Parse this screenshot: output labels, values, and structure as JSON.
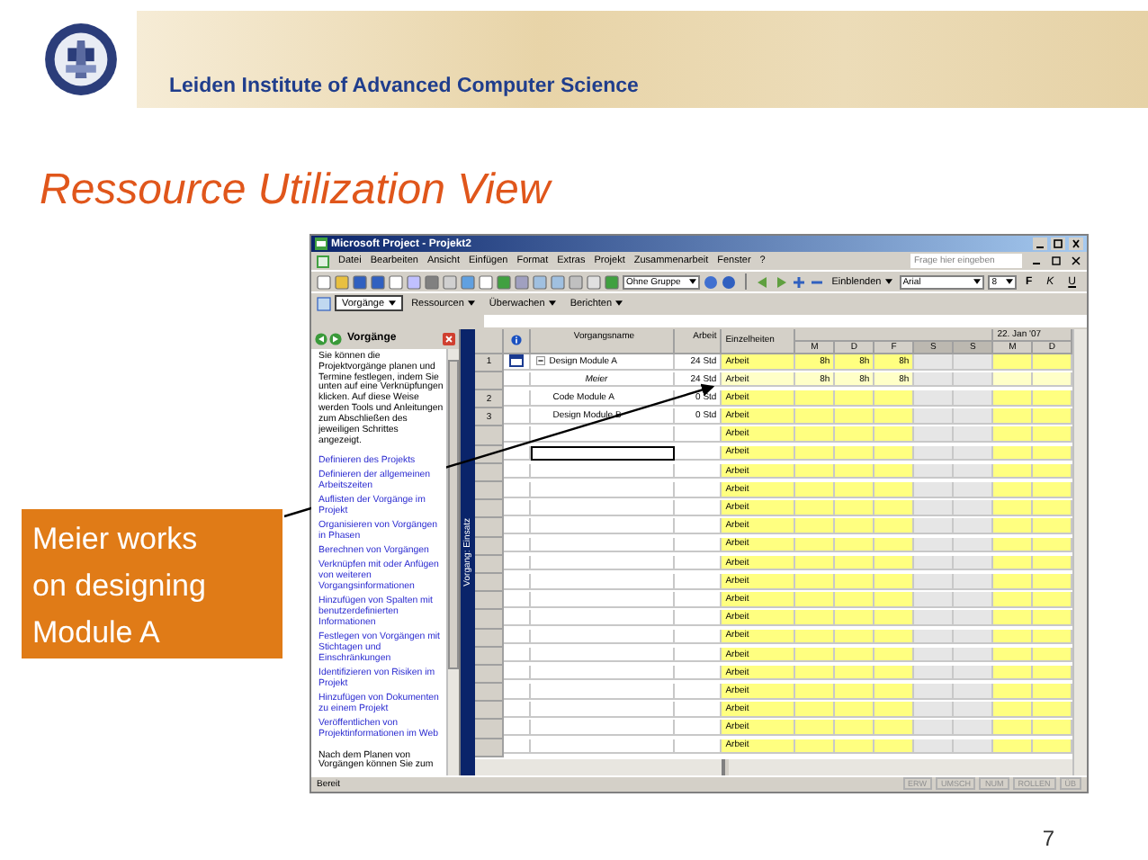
{
  "header": {
    "institute": "Leiden Institute of Advanced Computer Science"
  },
  "title": "Ressource Utilization View",
  "callout": {
    "text": "Meier works on designing Module A"
  },
  "app": {
    "window_title": "Microsoft Project - Projekt2",
    "menu": [
      "Datei",
      "Bearbeiten",
      "Ansicht",
      "Einfügen",
      "Format",
      "Extras",
      "Projekt",
      "Zusammenarbeit",
      "Fenster",
      "?"
    ],
    "help_placeholder": "Frage hier eingeben",
    "toolbar": {
      "group": "Ohne Gruppe",
      "show": "Einblenden",
      "font": "Arial",
      "size": "8",
      "format_buttons": [
        {
          "label": "F",
          "kind": "bold"
        },
        {
          "label": "K",
          "kind": "italic"
        },
        {
          "label": "U",
          "kind": "underline"
        }
      ]
    },
    "guide_toolbar": [
      {
        "label": "Vorgänge",
        "selected": true
      },
      {
        "label": "Ressourcen",
        "selected": false
      },
      {
        "label": "Überwachen",
        "selected": false
      },
      {
        "label": "Berichten",
        "selected": false
      }
    ],
    "task_pane": {
      "title": "Vorgänge",
      "intro": "Sie können die Projektvorgänge planen und Termine festlegen, indem Sie unten auf eine Verknüpfungen klicken. Auf diese Weise werden Tools und Anleitungen zum Abschließen des jeweiligen Schrittes angezeigt.",
      "links": [
        "Definieren des Projekts",
        "Definieren der allgemeinen Arbeitszeiten",
        "Auflisten der Vorgänge im Projekt",
        "Organisieren von Vorgängen in Phasen",
        "Berechnen von Vorgängen",
        "Verknüpfen mit oder Anfügen von weiteren Vorgangsinformationen",
        "Hinzufügen von Spalten mit benutzerdefinierten Informationen",
        "Festlegen von Vorgängen mit Stichtagen und Einschränkungen",
        "Identifizieren von Risiken im Projekt",
        "Hinzufügen von Dokumenten zu einem Projekt",
        "Veröffentlichen von Projektinformationen im Web"
      ],
      "footer": "Nach dem Planen von Vorgängen können Sie zum"
    },
    "view_bar_label": "Vorgang: Einsatz",
    "table": {
      "columns": [
        "Vorgangsname",
        "Arbeit"
      ],
      "details_header": "Einzelheiten",
      "week_label": "22. Jan '07",
      "days": [
        {
          "label": "M",
          "weekend": false
        },
        {
          "label": "D",
          "weekend": false
        },
        {
          "label": "F",
          "weekend": false
        },
        {
          "label": "S",
          "weekend": true
        },
        {
          "label": "S",
          "weekend": true
        },
        {
          "label": "M",
          "weekend": false
        },
        {
          "label": "D",
          "weekend": false
        }
      ],
      "rows": [
        {
          "id": "1",
          "name": "Design Module A",
          "work": "24 Std",
          "kind": "summary",
          "expanded": true,
          "indicator": true,
          "detail": "Arbeit",
          "cells": [
            "8h",
            "8h",
            "8h"
          ],
          "selected": false,
          "children": [
            {
              "name": "Meier",
              "work": "24 Std",
              "kind": "assignment",
              "detail": "Arbeit",
              "cells": [
                "8h",
                "8h",
                "8h"
              ],
              "selected": false
            }
          ]
        },
        {
          "id": "2",
          "name": "Code Module A",
          "work": "0 Std",
          "kind": "task",
          "indicator": false,
          "detail": "Arbeit",
          "selected": false
        },
        {
          "id": "3",
          "name": "Design Module B",
          "work": "0 Std",
          "kind": "task",
          "indicator": false,
          "detail": "Arbeit",
          "selected": false
        },
        {
          "kind": "empty",
          "detail": "Arbeit",
          "selected": false
        },
        {
          "kind": "empty",
          "detail": "Arbeit",
          "selected": true
        },
        {
          "kind": "empty",
          "detail": "Arbeit",
          "selected": false
        },
        {
          "kind": "empty",
          "detail": "Arbeit",
          "selected": false
        },
        {
          "kind": "empty",
          "detail": "Arbeit",
          "selected": false
        },
        {
          "kind": "empty",
          "detail": "Arbeit",
          "selected": false
        },
        {
          "kind": "empty",
          "detail": "Arbeit",
          "selected": false
        },
        {
          "kind": "empty",
          "detail": "Arbeit",
          "selected": false
        },
        {
          "kind": "empty",
          "detail": "Arbeit",
          "selected": false
        },
        {
          "kind": "empty",
          "detail": "Arbeit",
          "selected": false
        },
        {
          "kind": "empty",
          "detail": "Arbeit",
          "selected": false
        },
        {
          "kind": "empty",
          "detail": "Arbeit",
          "selected": false
        },
        {
          "kind": "empty",
          "detail": "Arbeit",
          "selected": false
        },
        {
          "kind": "empty",
          "detail": "Arbeit",
          "selected": false
        },
        {
          "kind": "empty",
          "detail": "Arbeit",
          "selected": false
        },
        {
          "kind": "empty",
          "detail": "Arbeit",
          "selected": false
        },
        {
          "kind": "empty",
          "detail": "Arbeit",
          "selected": false
        },
        {
          "kind": "empty",
          "detail": "Arbeit",
          "selected": false
        }
      ]
    },
    "status_bar": {
      "text": "Bereit",
      "indicators": [
        "ERW",
        "UMSCH",
        "NUM",
        "ROLLEN",
        "ÜB"
      ]
    }
  },
  "page_number": "7"
}
